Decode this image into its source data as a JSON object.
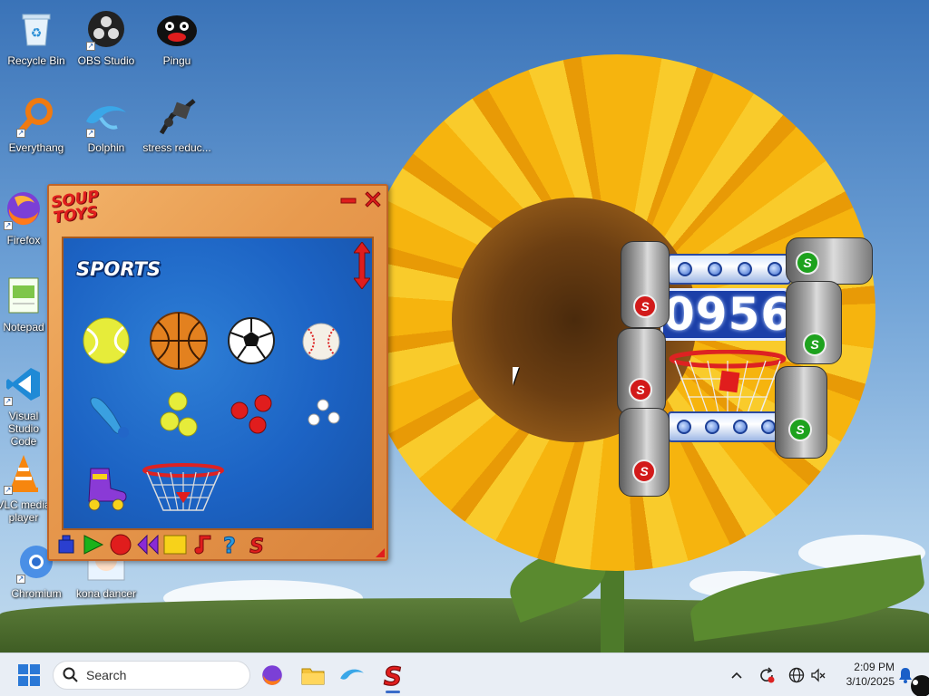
{
  "desktop": {
    "icons": [
      {
        "label": "Recycle Bin",
        "icon": "recycle-bin-icon"
      },
      {
        "label": "OBS Studio",
        "icon": "obs-icon"
      },
      {
        "label": "Pingu",
        "icon": "pingu-icon"
      },
      {
        "label": "Everythang",
        "icon": "magnifier-icon"
      },
      {
        "label": "Dolphin",
        "icon": "dolphin-icon"
      },
      {
        "label": "stress reduc...",
        "icon": "stress-reducer-icon"
      },
      {
        "label": "Firefox",
        "icon": "firefox-icon"
      },
      {
        "label": "Notepad",
        "icon": "notepad-icon"
      },
      {
        "label": "Visual Studio Code",
        "icon": "vscode-icon"
      },
      {
        "label": "VLC media player",
        "icon": "vlc-icon"
      },
      {
        "label": "Chromium",
        "icon": "chromium-icon"
      },
      {
        "label": "kona dancer",
        "icon": "kona-dancer-icon"
      }
    ]
  },
  "soup_toys": {
    "logo": "SOUP TOYS",
    "category": "SPORTS",
    "toys": [
      "tennis-ball",
      "basketball",
      "soccer-ball",
      "baseball",
      "shuttlecock",
      "yellow-balls",
      "red-balls",
      "white-balls",
      "roller-skate",
      "basketball-hoop"
    ],
    "toolbar": [
      "blue-toy",
      "play",
      "stop",
      "rewind",
      "square",
      "music",
      "help",
      "soup"
    ]
  },
  "scoreboard": {
    "score": "0956"
  },
  "taskbar": {
    "search_placeholder": "Search",
    "time": "2:09 PM",
    "date": "3/10/2025"
  },
  "colors": {
    "accent_red": "#e01d1d",
    "panel_blue": "#1c63c4",
    "window_orange": "#e89a4e"
  }
}
